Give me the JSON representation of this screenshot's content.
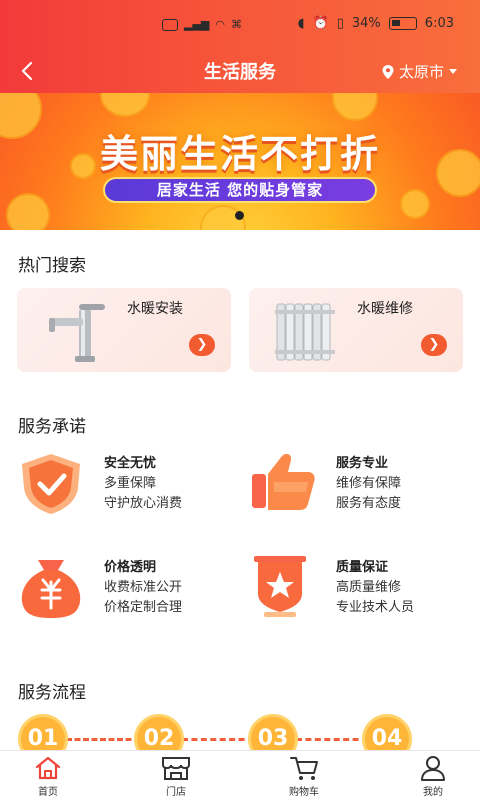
{
  "status_bar": {
    "time": "6:03",
    "battery": "34%"
  },
  "header": {
    "title": "生活服务",
    "city": "太原市"
  },
  "banner": {
    "title": "美丽生活不打折",
    "subtitle": "居家生活  您的贴身管家"
  },
  "hot_search": {
    "title": "热门搜索",
    "items": [
      {
        "label": "水暖安装",
        "icon": "faucet-icon"
      },
      {
        "label": "水暖维修",
        "icon": "radiator-icon"
      }
    ]
  },
  "promise": {
    "title": "服务承诺",
    "items": [
      {
        "title": "安全无忧",
        "lines": [
          "多重保障",
          "守护放心消费"
        ],
        "icon": "shield-check-icon"
      },
      {
        "title": "服务专业",
        "lines": [
          "维修有保障",
          "服务有态度"
        ],
        "icon": "thumbs-up-icon"
      },
      {
        "title": "价格透明",
        "lines": [
          "收费标准公开",
          "价格定制合理"
        ],
        "icon": "money-bag-icon"
      },
      {
        "title": "质量保证",
        "lines": [
          "高质量维修",
          "专业技术人员"
        ],
        "icon": "star-badge-icon"
      }
    ]
  },
  "flow": {
    "title": "服务流程",
    "steps": [
      "01",
      "02",
      "03",
      "04"
    ]
  },
  "tabbar": {
    "items": [
      {
        "label": "首页",
        "icon": "home-icon",
        "active": true
      },
      {
        "label": "门店",
        "icon": "store-icon"
      },
      {
        "label": "购物车",
        "icon": "cart-icon"
      },
      {
        "label": "我的",
        "icon": "user-icon"
      }
    ]
  },
  "colors": {
    "accent": "#f2453a",
    "orange": "#f86e3c",
    "pill": "#6a3ddc",
    "step": "#ffb638"
  }
}
